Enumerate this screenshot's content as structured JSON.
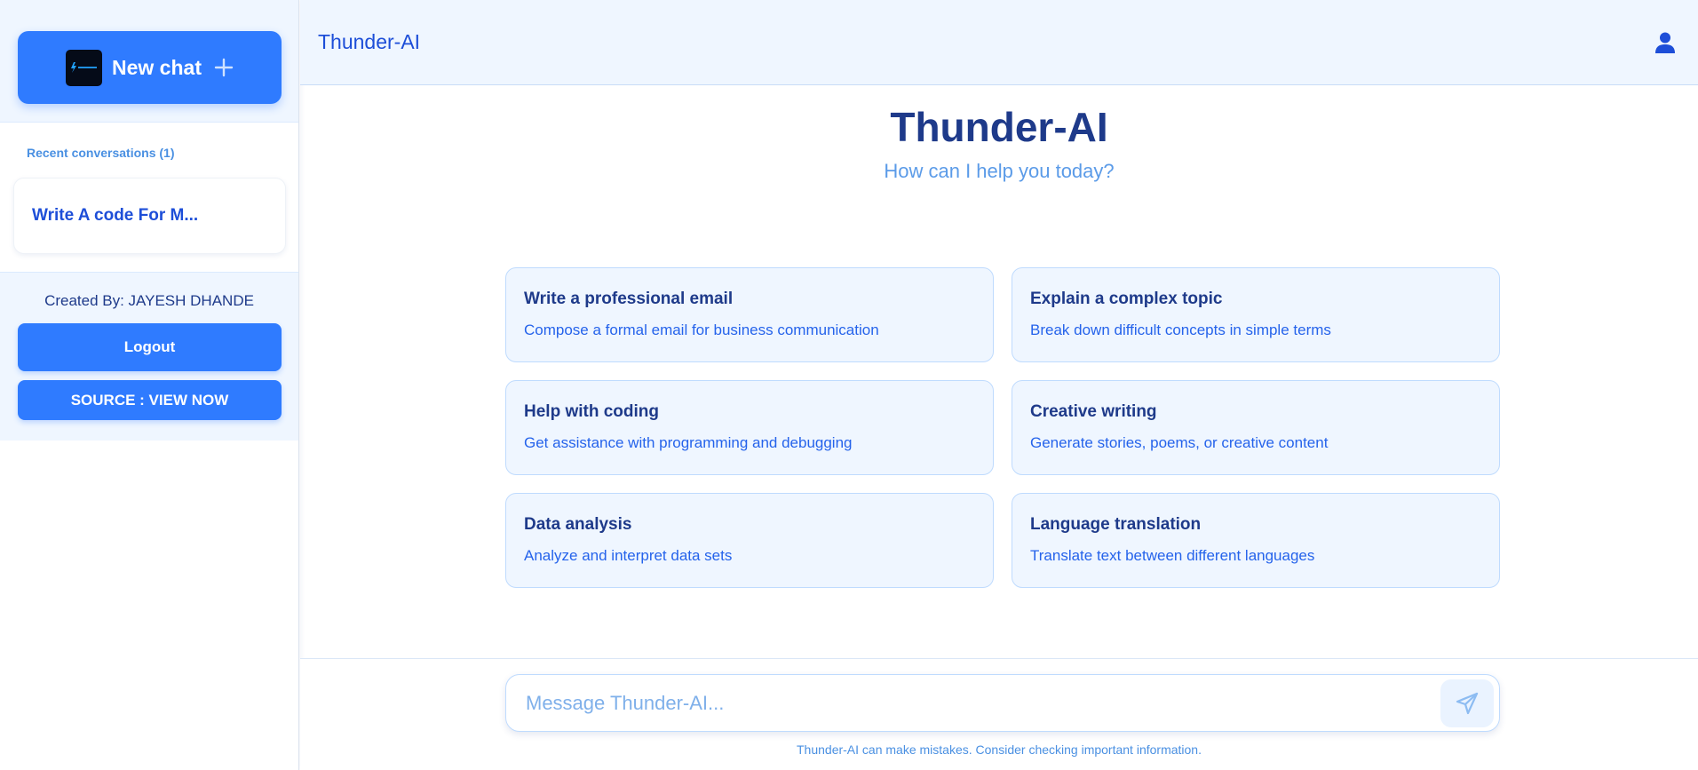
{
  "sidebar": {
    "new_chat_label": "New chat",
    "logo_text": "Thunder AI",
    "recent_title": "Recent conversations (1)",
    "conversations": [
      {
        "title": "Write A code For M..."
      }
    ],
    "created_by": "Created By: JAYESH DHANDE",
    "logout_label": "Logout",
    "source_label": "SOURCE : VIEW NOW"
  },
  "header": {
    "title": "Thunder-AI"
  },
  "hero": {
    "title": "Thunder-AI",
    "subtitle": "How can I help you today?"
  },
  "suggestions": [
    {
      "title": "Write a professional email",
      "desc": "Compose a formal email for business communication"
    },
    {
      "title": "Explain a complex topic",
      "desc": "Break down difficult concepts in simple terms"
    },
    {
      "title": "Help with coding",
      "desc": "Get assistance with programming and debugging"
    },
    {
      "title": "Creative writing",
      "desc": "Generate stories, poems, or creative content"
    },
    {
      "title": "Data analysis",
      "desc": "Analyze and interpret data sets"
    },
    {
      "title": "Language translation",
      "desc": "Translate text between different languages"
    }
  ],
  "composer": {
    "placeholder": "Message Thunder-AI...",
    "value": "",
    "disclaimer": "Thunder-AI can make mistakes. Consider checking important information."
  },
  "icons": {
    "new_chat": "plus-icon",
    "user": "user-icon",
    "send": "send-icon",
    "logo": "lightning-logo-icon"
  },
  "colors": {
    "accent": "#2f7bff",
    "panel_bg": "#eff6ff",
    "heading": "#1e3a8a",
    "link": "#1d4ed8"
  }
}
